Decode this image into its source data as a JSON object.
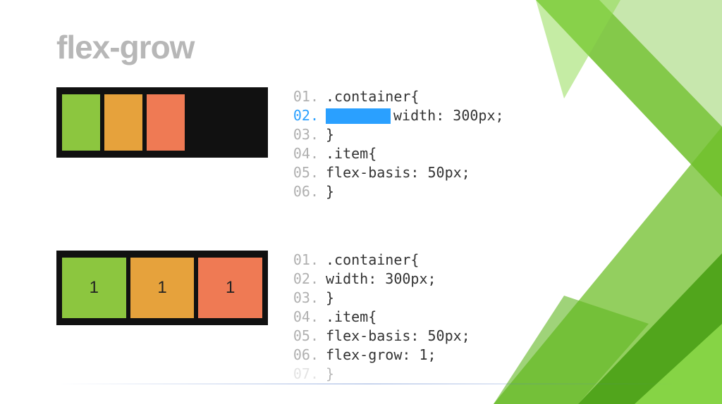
{
  "title": "flex-grow",
  "ex1": {
    "demo_labels": [
      "",
      "",
      ""
    ],
    "code": [
      {
        "n": "01.",
        "t": ".container{",
        "hl": false
      },
      {
        "n": "02.",
        "t": "width: 300px;",
        "hl": true
      },
      {
        "n": "03.",
        "t": "}",
        "hl": false
      },
      {
        "n": "04.",
        "t": ".item{",
        "hl": false
      },
      {
        "n": "05.",
        "t": "        flex-basis: 50px;",
        "hl": false
      },
      {
        "n": "06.",
        "t": "}",
        "hl": false
      }
    ]
  },
  "ex2": {
    "demo_labels": [
      "1",
      "1",
      "1"
    ],
    "code": [
      {
        "n": "01.",
        "t": ".container{",
        "hl": false
      },
      {
        "n": "02.",
        "t": "        width: 300px;",
        "hl": false
      },
      {
        "n": "03.",
        "t": "}",
        "hl": false
      },
      {
        "n": "04.",
        "t": ".item{",
        "hl": false
      },
      {
        "n": "05.",
        "t": "        flex-basis: 50px;",
        "hl": false
      },
      {
        "n": "06.",
        "t": "        flex-grow: 1;",
        "hl": false
      },
      {
        "n": "07.",
        "t": "}",
        "hl": false
      }
    ]
  }
}
